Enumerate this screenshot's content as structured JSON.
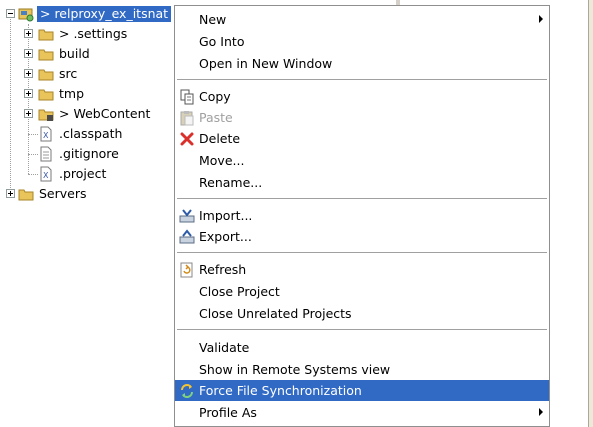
{
  "tree": {
    "project": "> relproxy_ex_itsnat",
    "children": [
      {
        "label": "> .settings",
        "type": "folder"
      },
      {
        "label": "build",
        "type": "folder"
      },
      {
        "label": "src",
        "type": "folder"
      },
      {
        "label": "tmp",
        "type": "folder"
      },
      {
        "label": "> WebContent",
        "type": "folder"
      },
      {
        "label": ".classpath",
        "type": "file"
      },
      {
        "label": ".gitignore",
        "type": "file"
      },
      {
        "label": ".project",
        "type": "file"
      }
    ],
    "servers": "Servers"
  },
  "menu": {
    "items": [
      {
        "label": "New",
        "icon": "",
        "submenu": true,
        "disabled": false
      },
      {
        "label": "Go Into",
        "icon": "",
        "submenu": false,
        "disabled": false
      },
      {
        "label": "Open in New Window",
        "icon": "",
        "submenu": false,
        "disabled": false
      },
      {
        "label": "Copy",
        "icon": "copy-icon",
        "submenu": false,
        "disabled": false
      },
      {
        "label": "Paste",
        "icon": "paste-icon",
        "submenu": false,
        "disabled": true
      },
      {
        "label": "Delete",
        "icon": "delete-icon",
        "submenu": false,
        "disabled": false
      },
      {
        "label": "Move...",
        "icon": "",
        "submenu": false,
        "disabled": false
      },
      {
        "label": "Rename...",
        "icon": "",
        "submenu": false,
        "disabled": false
      },
      {
        "label": "Import...",
        "icon": "import-icon",
        "submenu": false,
        "disabled": false
      },
      {
        "label": "Export...",
        "icon": "export-icon",
        "submenu": false,
        "disabled": false
      },
      {
        "label": "Refresh",
        "icon": "refresh-icon",
        "submenu": false,
        "disabled": false
      },
      {
        "label": "Close Project",
        "icon": "",
        "submenu": false,
        "disabled": false
      },
      {
        "label": "Close Unrelated Projects",
        "icon": "",
        "submenu": false,
        "disabled": false
      },
      {
        "label": "Validate",
        "icon": "",
        "submenu": false,
        "disabled": false
      },
      {
        "label": "Show in Remote Systems view",
        "icon": "",
        "submenu": false,
        "disabled": false
      },
      {
        "label": "Force File Synchronization",
        "icon": "sync-icon",
        "submenu": false,
        "disabled": false,
        "highlighted": true
      },
      {
        "label": "Profile As",
        "icon": "",
        "submenu": true,
        "disabled": false
      }
    ]
  },
  "colors": {
    "selection": "#316ac5",
    "folder": "#e8c45a",
    "delete": "#d9302c",
    "separator": "#a0a0a0"
  }
}
